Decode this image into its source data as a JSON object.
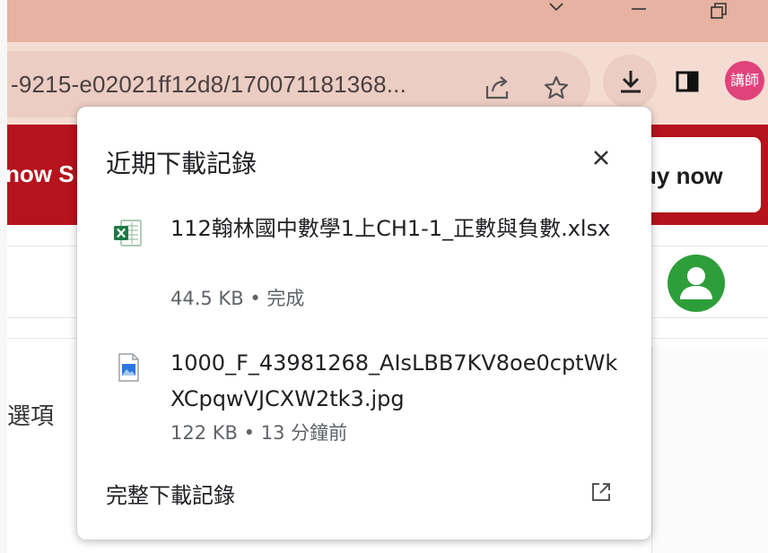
{
  "browser": {
    "url_text": "-9215-e02021ff12d8/170071181368...",
    "profile_label": "講師"
  },
  "page": {
    "banner_left_text": "now S",
    "buy_button_label": "uy now",
    "options_label": "選項"
  },
  "downloads": {
    "title": "近期下載記錄",
    "items": [
      {
        "file_name": "112翰林國中數學1上CH1-1_正數與負數.xlsx",
        "size": "44.5 KB",
        "separator": "•",
        "status": "完成",
        "icon": "excel-file-icon"
      },
      {
        "file_name": "1000_F_43981268_AIsLBB7KV8oe0cptWkXCpqwVJCXW2tk3.jpg",
        "size": "122 KB",
        "separator": "•",
        "status": "13 分鐘前",
        "icon": "image-file-icon"
      }
    ],
    "full_history_label": "完整下載記錄"
  },
  "colors": {
    "titlebar": "#e6b2a1",
    "toolbar": "#f5dcd2",
    "banner_red": "#b5131d",
    "avatar_green": "#2e9e3a",
    "profile_pink": "#e0427a"
  }
}
